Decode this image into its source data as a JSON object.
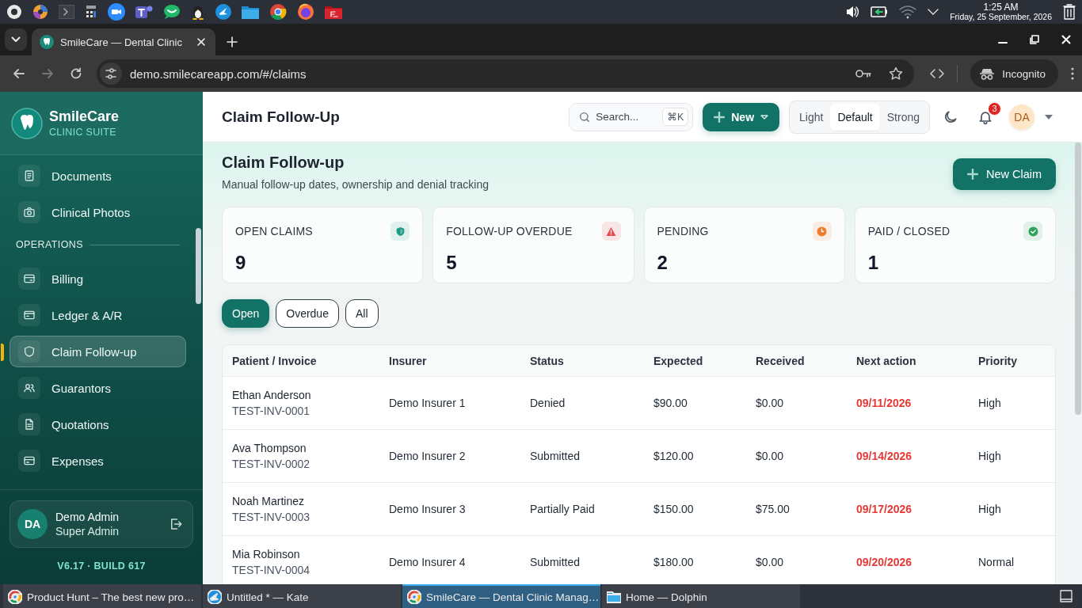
{
  "desktop_panel": {
    "time": "1:25 AM",
    "date": "Friday, 25 September, 2026"
  },
  "browser": {
    "tab": {
      "title": "SmileCare — Dental Clinic",
      "selected": true
    },
    "url": "demo.smilecareapp.com/#/claims",
    "profile": "Incognito",
    "forward_disabled": true
  },
  "sidebar": {
    "brand": "SmileCare",
    "subtitle": "CLINIC SUITE",
    "items": [
      {
        "kind": "link",
        "label": "Documents",
        "selected": false
      },
      {
        "kind": "link",
        "label": "Clinical Photos",
        "selected": false
      },
      {
        "kind": "section",
        "label": "OPERATIONS"
      },
      {
        "kind": "link",
        "label": "Billing",
        "selected": false
      },
      {
        "kind": "link",
        "label": "Ledger & A/R",
        "selected": false
      },
      {
        "kind": "link",
        "label": "Claim Follow-up",
        "selected": true
      },
      {
        "kind": "link",
        "label": "Guarantors",
        "selected": false
      },
      {
        "kind": "link",
        "label": "Quotations",
        "selected": false
      },
      {
        "kind": "link",
        "label": "Expenses",
        "selected": false
      }
    ],
    "user": {
      "initials": "DA",
      "name": "Demo Admin",
      "role": "Super Admin"
    },
    "version": "V6.17 · BUILD 617"
  },
  "header": {
    "title": "Claim Follow-Up",
    "search": {
      "placeholder": "Search...",
      "shortcut": "⌘K"
    },
    "new_button": "New",
    "density": [
      {
        "label": "Light",
        "selected": false
      },
      {
        "label": "Default",
        "selected": true
      },
      {
        "label": "Strong",
        "selected": false
      }
    ],
    "notifications": "3",
    "avatar": "DA"
  },
  "page": {
    "title": "Claim Follow-up",
    "subtitle": "Manual follow-up dates, ownership and denial tracking",
    "action": "New Claim",
    "stats": [
      {
        "label": "OPEN CLAIMS",
        "value": "9",
        "color": "#1f9a84"
      },
      {
        "label": "FOLLOW-UP OVERDUE",
        "value": "5",
        "color": "#e5484d"
      },
      {
        "label": "PENDING",
        "value": "2",
        "color": "#ee7d2b"
      },
      {
        "label": "PAID / CLOSED",
        "value": "1",
        "color": "#2fa35a"
      }
    ],
    "filters": [
      {
        "label": "Open",
        "selected": true
      },
      {
        "label": "Overdue",
        "selected": false
      },
      {
        "label": "All",
        "selected": false
      }
    ],
    "table": {
      "columns": [
        "Patient / Invoice",
        "Insurer",
        "Status",
        "Expected",
        "Received",
        "Next action",
        "Priority"
      ],
      "rows": [
        {
          "patient": "Ethan Anderson",
          "invoice": "TEST-INV-0001",
          "insurer": "Demo Insurer 1",
          "status": "Denied",
          "expected": "$90.00",
          "received": "$0.00",
          "next_action": "09/11/2026",
          "overdue": true,
          "priority": "High"
        },
        {
          "patient": "Ava Thompson",
          "invoice": "TEST-INV-0002",
          "insurer": "Demo Insurer 2",
          "status": "Submitted",
          "expected": "$120.00",
          "received": "$0.00",
          "next_action": "09/14/2026",
          "overdue": true,
          "priority": "High"
        },
        {
          "patient": "Noah Martinez",
          "invoice": "TEST-INV-0003",
          "insurer": "Demo Insurer 3",
          "status": "Partially Paid",
          "expected": "$150.00",
          "received": "$75.00",
          "next_action": "09/17/2026",
          "overdue": true,
          "priority": "High"
        },
        {
          "patient": "Mia Robinson",
          "invoice": "TEST-INV-0004",
          "insurer": "Demo Insurer 4",
          "status": "Submitted",
          "expected": "$180.00",
          "received": "$0.00",
          "next_action": "09/20/2026",
          "overdue": true,
          "priority": "Normal"
        }
      ]
    }
  },
  "taskbar": {
    "tasks": [
      {
        "title": "Product Hunt – The best new pro…",
        "selected": false
      },
      {
        "title": "Untitled * — Kate",
        "selected": false
      },
      {
        "title": "SmileCare — Dental Clinic Manag…",
        "selected": true
      },
      {
        "title": "Home — Dolphin",
        "selected": false
      }
    ]
  }
}
